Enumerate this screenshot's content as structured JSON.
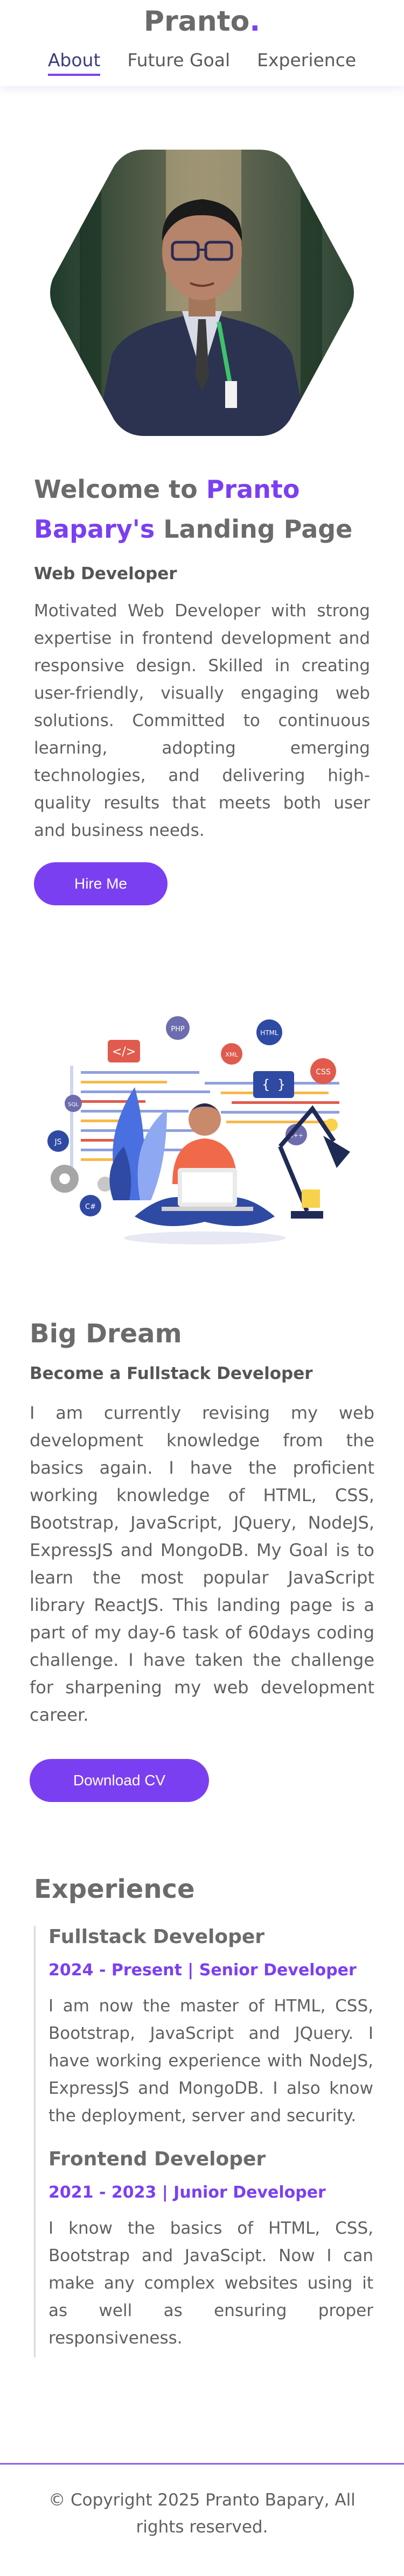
{
  "header": {
    "logo_text": "Pranto",
    "logo_dot": ".",
    "nav": [
      {
        "label": "About",
        "active": true
      },
      {
        "label": "Future Goal",
        "active": false
      },
      {
        "label": "Experience",
        "active": false
      }
    ]
  },
  "hero": {
    "title_prefix": "Welcome to ",
    "title_name": "Pranto Bapary's",
    "title_suffix": " Landing Page",
    "subtitle": "Web Developer",
    "description": "Motivated Web Developer with strong expertise in frontend development and responsive design. Skilled in creating user-friendly, visually engaging web solutions. Committed to continuous learning, adopting emerging technologies, and delivering high-quality results that meets both user and business needs.",
    "cta_label": "Hire Me"
  },
  "dream": {
    "title": "Big Dream",
    "subtitle": "Become a Fullstack Developer",
    "description": "I am currently revising my web development knowledge from the basics again. I have the proficient working knowledge of HTML, CSS, Bootstrap, JavaScript, JQuery, NodeJS, ExpressJS and MongoDB. My Goal is to learn the most popular JavaScript library ReactJS. This landing page is a part of my day-6 task of 60days coding challenge. I have taken the challenge for sharpening my web development career.",
    "cta_label": "Download CV"
  },
  "illustration": {
    "badges": [
      "PHP",
      "HTML",
      "CSS",
      "XML",
      "JS",
      "C#",
      "C++",
      "SQL"
    ]
  },
  "experience": {
    "title": "Experience",
    "items": [
      {
        "role": "Fullstack Developer",
        "period": "2024 - Present | Senior Developer",
        "description": "I am now the master of HTML, CSS, Bootstrap, JavaScript and JQuery. I have working experience with NodeJS, ExpressJS and MongoDB. I also know the deployment, server and security."
      },
      {
        "role": "Frontend Developer",
        "period": "2021 - 2023 | Junior Developer",
        "description": "I know the basics of HTML, CSS, Bootstrap and JavaScipt. Now I can make any complex websites using it as well as ensuring proper responsiveness."
      }
    ]
  },
  "footer": {
    "copyright": "© Copyright 2025 Pranto Bapary, All rights reserved."
  },
  "colors": {
    "accent": "#7b3ff2",
    "text": "#606060",
    "heading": "#6b6b6b"
  }
}
